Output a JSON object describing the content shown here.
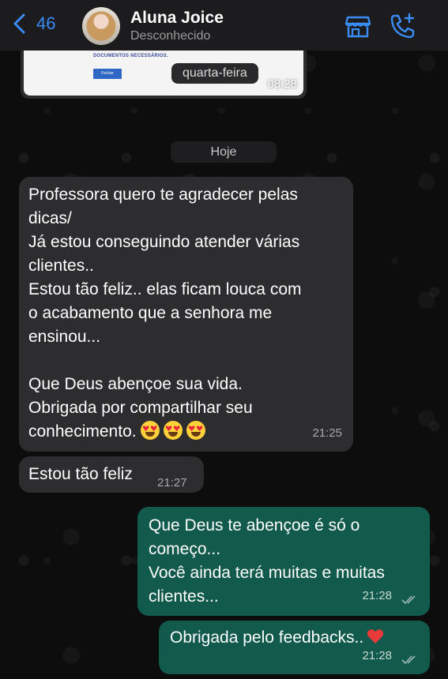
{
  "header": {
    "back_count": "46",
    "contact_name": "Aluna Joice",
    "contact_status": "Desconhecido",
    "accent": "#3a8cf6"
  },
  "previous_message": {
    "doc_text": "DOCUMENTOS NECESSÁRIOS.",
    "doc_button": "Fechar",
    "time": "08:28"
  },
  "day_label": "quarta-feira",
  "date_label": "Hoje",
  "messages": [
    {
      "direction": "incoming",
      "text": "Professora quero te agradecer pelas\ndicas/\nJá estou conseguindo atender várias\nclientes..\nEstou tão feliz.. elas ficam louca com\no acabamento que a senhora me\nensinou...\n\nQue Deus abençoe sua vida.\nObrigada por compartilhar seu\nconhecimento.",
      "emoji": [
        "smiling-face-with-heart-eyes",
        "smiling-face-with-heart-eyes",
        "smiling-face-with-heart-eyes"
      ],
      "time": "21:25"
    },
    {
      "direction": "incoming",
      "text": "Estou tão feliz",
      "time": "21:27"
    },
    {
      "direction": "outgoing",
      "text": "Que Deus te abençoe é só o\ncomeço...\nVocê ainda terá muitas e muitas\nclientes...",
      "time": "21:28",
      "status": "read-double-check"
    },
    {
      "direction": "outgoing",
      "text": "Obrigada pelo feedbacks..",
      "emoji": [
        "red-heart"
      ],
      "time": "21:28",
      "status": "read-double-check"
    }
  ],
  "colors": {
    "incoming_bubble": "#2d2d2f",
    "outgoing_bubble": "#115a4c",
    "header_bg": "#1c1c1e"
  }
}
